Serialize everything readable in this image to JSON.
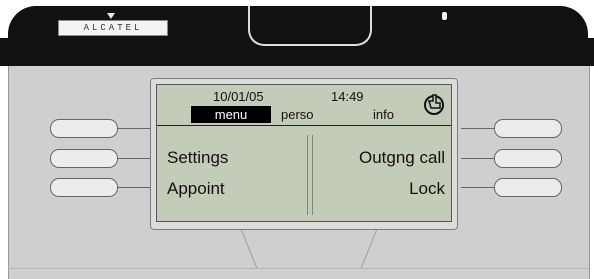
{
  "brand": {
    "logo_text": "ALCATEL"
  },
  "status_bar": {
    "date": "10/01/05",
    "time": "14:49"
  },
  "tabs": [
    {
      "label": "menu",
      "selected": true
    },
    {
      "label": "perso",
      "selected": false
    },
    {
      "label": "info",
      "selected": false
    }
  ],
  "menu_items": {
    "left": [
      "Settings",
      "Appoint"
    ],
    "right": [
      "Outgng call",
      "Lock"
    ]
  },
  "icons": {
    "info": "phone-hand-icon"
  },
  "colors": {
    "screen": "#c3ccb9",
    "bezel": "#111111",
    "body": "#cfcfcf"
  }
}
